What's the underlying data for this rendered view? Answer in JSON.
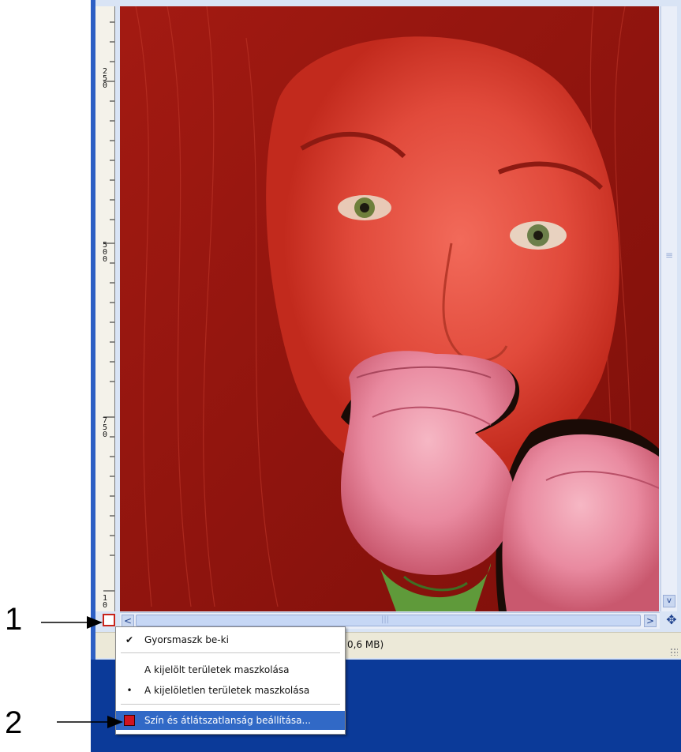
{
  "ruler": {
    "labels": [
      "250",
      "500",
      "750",
      "10"
    ]
  },
  "statusbar": {
    "text": "0,6 MB)"
  },
  "scroll": {
    "left_arrow": "<",
    "right_arrow": ">",
    "down_arrow": "v",
    "thumb_grip": "|||",
    "vthumb_grip": "≡"
  },
  "menu": {
    "items": [
      {
        "mark": "✔",
        "label": "Gyorsmaszk be-ki"
      },
      {
        "mark": "",
        "label": "A kijelölt területek maszkolása"
      },
      {
        "mark": "•",
        "label": "A kijelöletlen területek maszkolása"
      },
      {
        "mark": "",
        "label": "Szín és átlátszatlanság beállítása..."
      }
    ],
    "swatch_color": "#d0141f"
  },
  "callouts": {
    "one": "1",
    "two": "2"
  },
  "colors": {
    "mask_red": "#b01f16",
    "window_border": "#2d5fc4",
    "desktop": "#0b3a99",
    "highlight": "#3169c6"
  }
}
